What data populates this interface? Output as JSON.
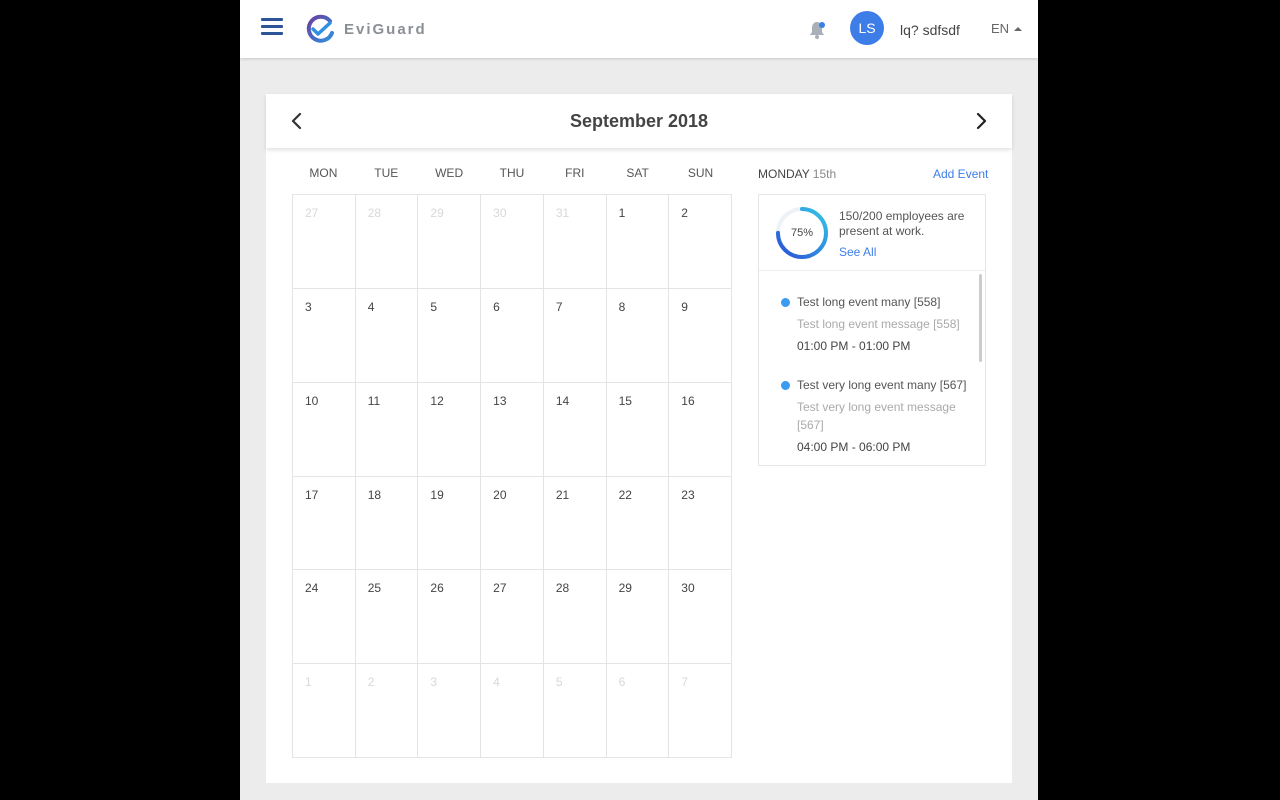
{
  "header": {
    "brand": "EviGuard",
    "user_initials": "LS",
    "user_name": "lq? sdfsdf",
    "language": "EN"
  },
  "calendar": {
    "month_title": "September 2018",
    "weekdays": [
      "MON",
      "TUE",
      "WED",
      "THU",
      "FRI",
      "SAT",
      "SUN"
    ],
    "weeks": [
      [
        {
          "d": "27",
          "o": true
        },
        {
          "d": "28",
          "o": true
        },
        {
          "d": "29",
          "o": true
        },
        {
          "d": "30",
          "o": true
        },
        {
          "d": "31",
          "o": true
        },
        {
          "d": "1",
          "o": false
        },
        {
          "d": "2",
          "o": false
        }
      ],
      [
        {
          "d": "3",
          "o": false
        },
        {
          "d": "4",
          "o": false
        },
        {
          "d": "5",
          "o": false
        },
        {
          "d": "6",
          "o": false
        },
        {
          "d": "7",
          "o": false
        },
        {
          "d": "8",
          "o": false
        },
        {
          "d": "9",
          "o": false
        }
      ],
      [
        {
          "d": "10",
          "o": false
        },
        {
          "d": "11",
          "o": false
        },
        {
          "d": "12",
          "o": false
        },
        {
          "d": "13",
          "o": false
        },
        {
          "d": "14",
          "o": false
        },
        {
          "d": "15",
          "o": false
        },
        {
          "d": "16",
          "o": false
        }
      ],
      [
        {
          "d": "17",
          "o": false
        },
        {
          "d": "18",
          "o": false
        },
        {
          "d": "19",
          "o": false
        },
        {
          "d": "20",
          "o": false
        },
        {
          "d": "21",
          "o": false
        },
        {
          "d": "22",
          "o": false
        },
        {
          "d": "23",
          "o": false
        }
      ],
      [
        {
          "d": "24",
          "o": false
        },
        {
          "d": "25",
          "o": false
        },
        {
          "d": "26",
          "o": false
        },
        {
          "d": "27",
          "o": false
        },
        {
          "d": "28",
          "o": false
        },
        {
          "d": "29",
          "o": false
        },
        {
          "d": "30",
          "o": false
        }
      ],
      [
        {
          "d": "1",
          "o": true
        },
        {
          "d": "2",
          "o": true
        },
        {
          "d": "3",
          "o": true
        },
        {
          "d": "4",
          "o": true
        },
        {
          "d": "5",
          "o": true
        },
        {
          "d": "6",
          "o": true
        },
        {
          "d": "7",
          "o": true
        }
      ]
    ]
  },
  "side": {
    "day_name": "MONDAY",
    "day_number": "15th",
    "add_event": "Add Event",
    "presence_percent": "75%",
    "presence_fraction": 0.75,
    "presence_text": "150/200 employees are present at work.",
    "see_all": "See All",
    "events": [
      {
        "title": "Test long event many [558]",
        "message": "Test long event message [558]",
        "time": "01:00 PM - 01:00 PM"
      },
      {
        "title": "Test very long event many [567]",
        "message": "Test very long event message [567]",
        "time": "04:00 PM - 06:00 PM"
      }
    ]
  },
  "colors": {
    "accent": "#3d7de8",
    "event_dot": "#3a9bf0",
    "nav_blue": "#2b5597"
  }
}
